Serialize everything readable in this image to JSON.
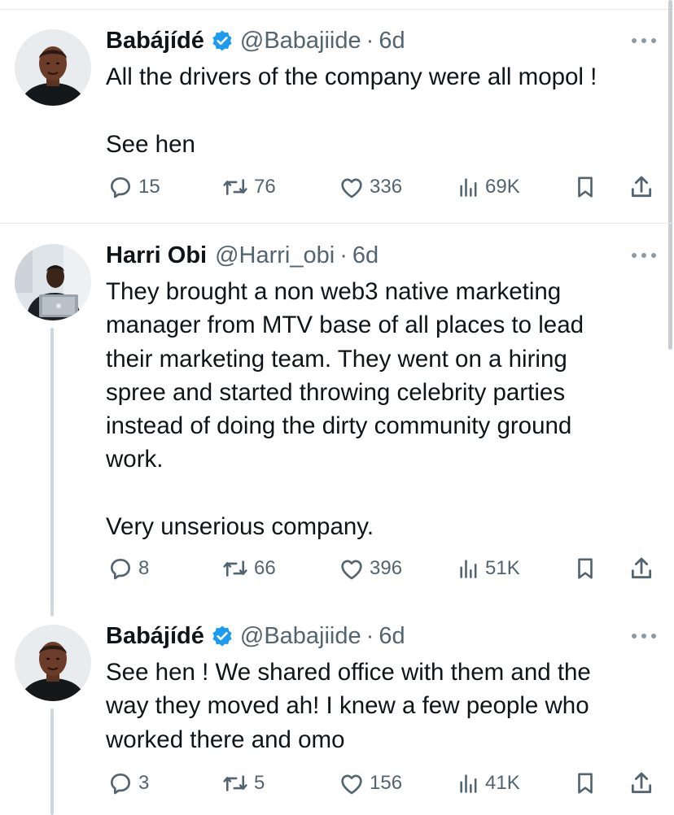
{
  "tweets": [
    {
      "author": {
        "name": "Babájídé",
        "verified": true,
        "handle": "@Babajiide",
        "age": "6d"
      },
      "avatar_icon": "avatar-babajide",
      "lines": [
        "All the drivers of the company were all mopol !",
        "",
        "See hen"
      ],
      "stats": {
        "replies": "15",
        "reposts": "76",
        "likes": "336",
        "views": "69K"
      }
    },
    {
      "author": {
        "name": "Harri Obi",
        "verified": false,
        "handle": "@Harri_obi",
        "age": "6d"
      },
      "avatar_icon": "avatar-harri-obi",
      "lines": [
        "They brought a non web3 native marketing",
        "manager from MTV base of all places to lead",
        "their marketing team. They went on a hiring",
        "spree and started throwing celebrity parties",
        "instead of doing the dirty community ground",
        "work.",
        "",
        "Very unserious company."
      ],
      "stats": {
        "replies": "8",
        "reposts": "66",
        "likes": "396",
        "views": "51K"
      }
    },
    {
      "author": {
        "name": "Babájídé",
        "verified": true,
        "handle": "@Babajiide",
        "age": "6d"
      },
      "avatar_icon": "avatar-babajide",
      "lines": [
        "See hen ! We shared office with them and the",
        "way they moved ah! I knew a few people who",
        "worked there and omo"
      ],
      "stats": {
        "replies": "3",
        "reposts": "5",
        "likes": "156",
        "views": "41K"
      }
    }
  ],
  "separator": "·",
  "icons": [
    "verified-badge-icon",
    "more-icon",
    "reply-icon",
    "repost-icon",
    "like-icon",
    "views-icon",
    "bookmark-icon",
    "share-icon"
  ],
  "colors": {
    "text": "#0f1419",
    "secondary": "#536471",
    "verified": "#1d9bf0",
    "divider": "#e7e9ea",
    "thread": "#cfd9de"
  }
}
